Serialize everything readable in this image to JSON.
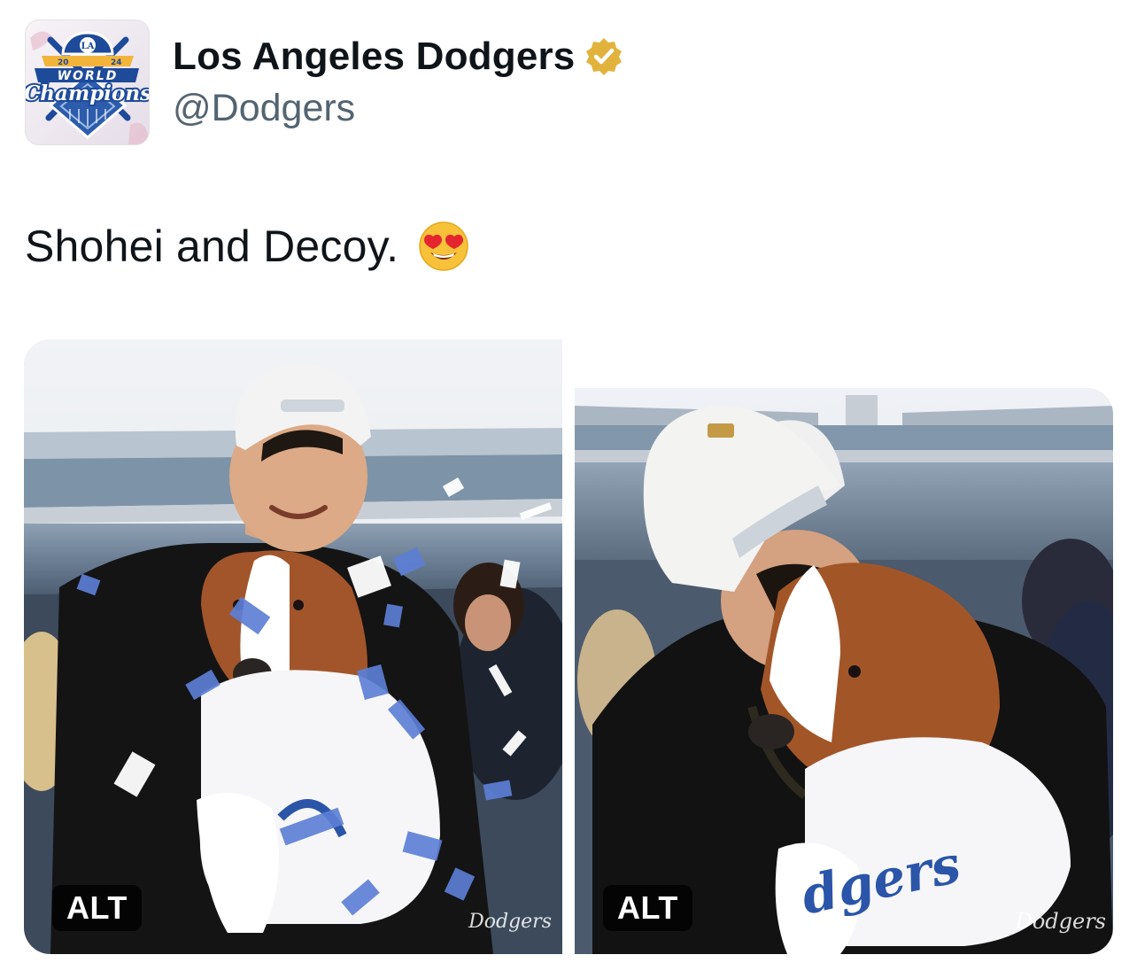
{
  "author": {
    "display_name": "Los Angeles Dodgers",
    "handle": "@Dodgers",
    "verified_badge_icon": "verified-gold-badge",
    "avatar": {
      "badge_text": "WORLD",
      "script_text": "Champions",
      "cap_logo": "LA",
      "year_left": "20",
      "year_right": "24",
      "colors": {
        "navy": "#1e4a9a",
        "gold": "#f2b43a",
        "blue": "#3d78c9"
      }
    }
  },
  "tweet": {
    "text": "Shohei and Decoy.",
    "emoji_icon": "heart-eyes-emoji"
  },
  "media": [
    {
      "alt_label": "ALT",
      "description_icon": "photo-shohei-holding-decoy-confetti",
      "watermark": "Dodgers"
    },
    {
      "alt_label": "ALT",
      "description_icon": "photo-shohei-kissing-decoy",
      "watermark": "Dodgers",
      "jersey_text": "dgers"
    }
  ],
  "colors": {
    "verified_gold": "#e2b33c",
    "text_primary": "#0f1419",
    "text_secondary": "#536471"
  }
}
